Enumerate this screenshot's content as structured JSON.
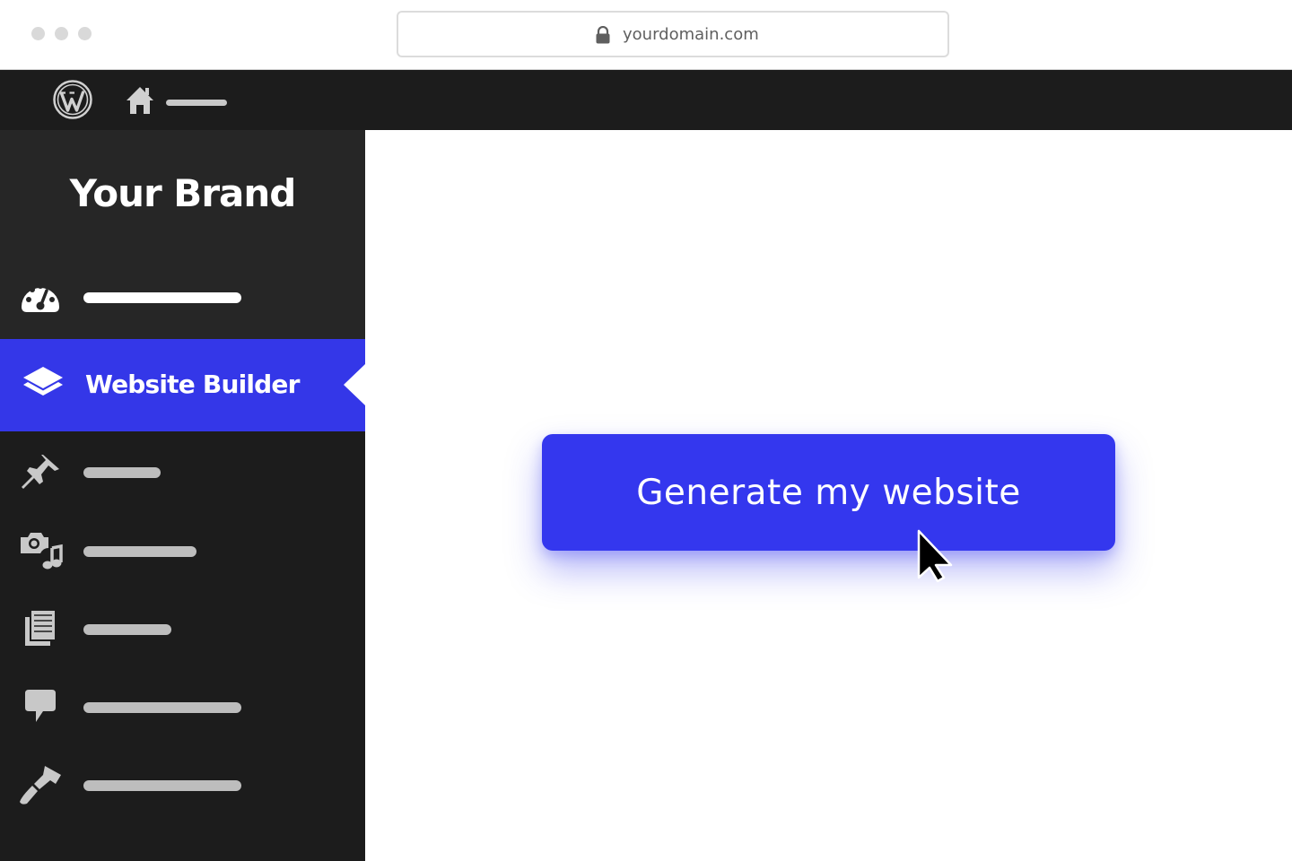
{
  "browser": {
    "url": "yourdomain.com"
  },
  "admin_bar": {
    "icons": [
      "wordpress-logo-icon",
      "home-icon"
    ]
  },
  "sidebar": {
    "brand": "Your Brand",
    "active_item": {
      "label": "Website Builder",
      "icon": "layers-icon"
    },
    "items": [
      {
        "icon": "dashboard-gauge-icon"
      },
      {
        "icon": "pushpin-icon"
      },
      {
        "icon": "media-icon"
      },
      {
        "icon": "pages-icon"
      },
      {
        "icon": "comment-icon"
      },
      {
        "icon": "paintbrush-icon"
      }
    ]
  },
  "main": {
    "cta_label": "Generate my website"
  },
  "colors": {
    "accent": "#3437EE",
    "admin_bar": "#1C1C1C",
    "sidebar_header": "#262626"
  }
}
